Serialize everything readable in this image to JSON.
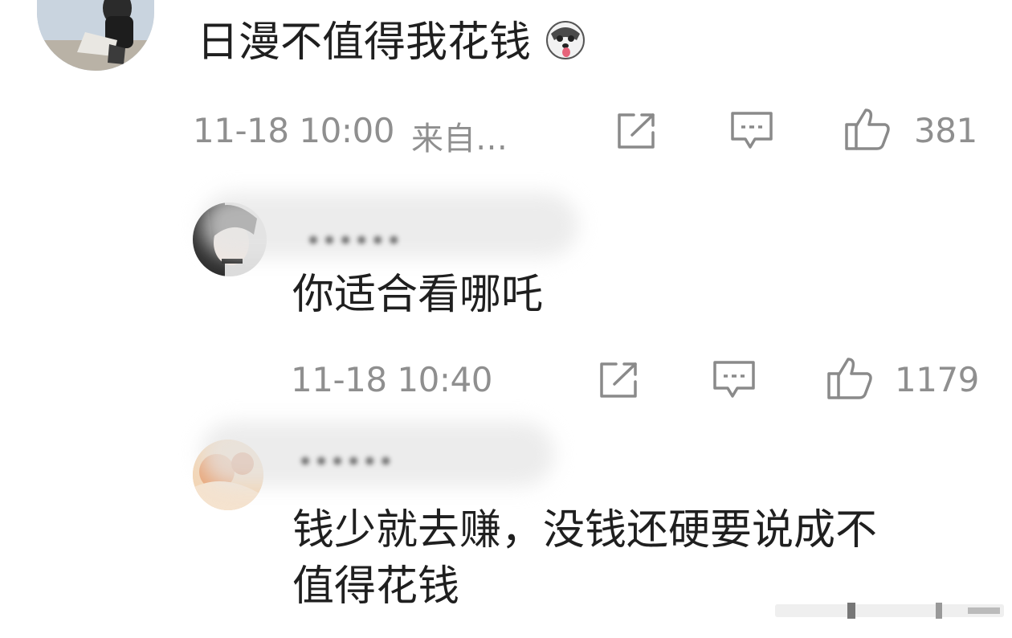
{
  "comments": [
    {
      "text": "日漫不值得我花钱",
      "time": "11-18 10:00",
      "source": "来自…",
      "likes": "381",
      "emoji_icon": "husky-face-icon"
    },
    {
      "text": "你适合看哪吒",
      "time": "11-18 10:40",
      "likes": "1179"
    },
    {
      "text_line1": "钱少就去赚，没钱还硬要说成不",
      "text_line2": "值得花钱"
    }
  ],
  "icons": {
    "share": "share-icon",
    "comment": "comment-icon",
    "like": "thumbs-up-icon"
  },
  "colors": {
    "text": "#1f1f1f",
    "meta": "#8f8f8f",
    "icon": "#8a8a8a"
  }
}
